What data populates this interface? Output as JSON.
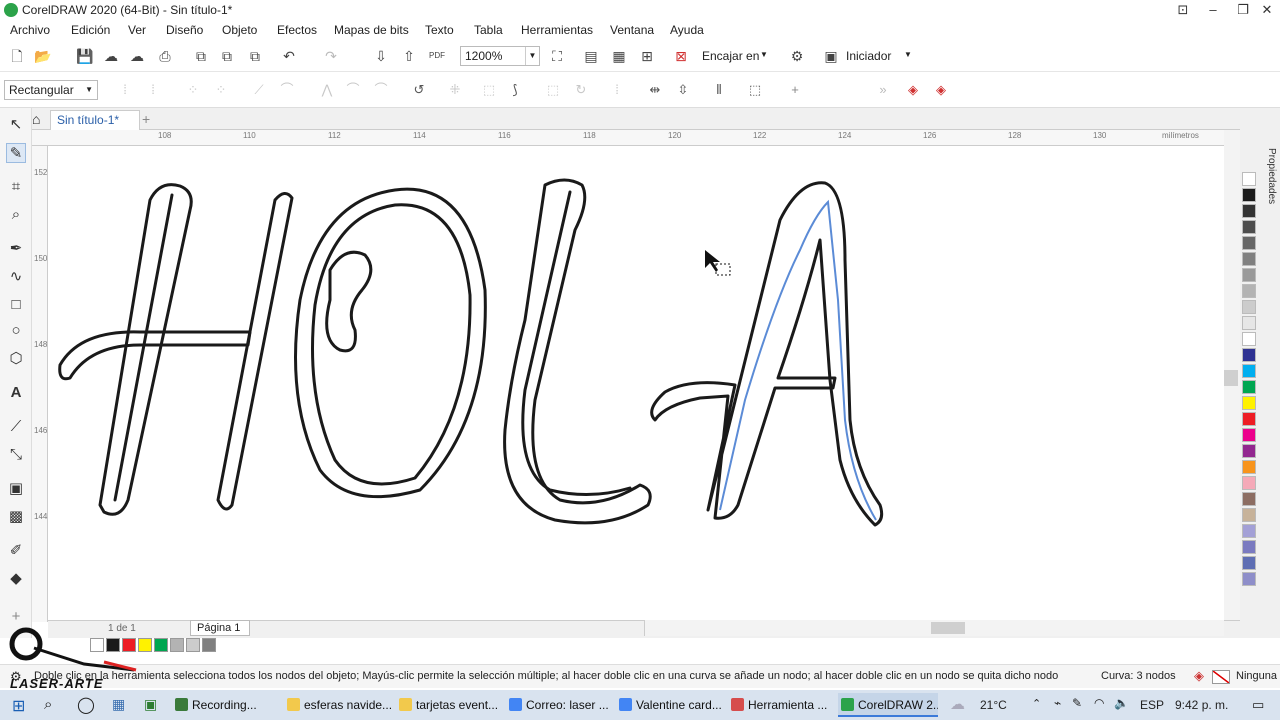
{
  "window": {
    "title": "CorelDRAW 2020 (64-Bit) - Sin título-1*",
    "controls": {
      "minimize": "–",
      "restore": "❐",
      "close": "✕",
      "extra": "⊡"
    }
  },
  "menu": [
    "Archivo",
    "Edición",
    "Ver",
    "Diseño",
    "Objeto",
    "Efectos",
    "Mapas de bits",
    "Texto",
    "Tabla",
    "Herramientas",
    "Ventana",
    "Ayuda"
  ],
  "toolbar": {
    "zoom": "1200%",
    "snap_label": "Encajar en",
    "launcher_label": "Iniciador"
  },
  "property_bar": {
    "shape_mode": "Rectangular"
  },
  "document": {
    "tab_label": "Sin título-1*",
    "add_tab": "+",
    "page_label": "Página 1",
    "page_nav": "1 de 1"
  },
  "ruler": {
    "units": "milímetros",
    "h_ticks": [
      "108",
      "110",
      "112",
      "114",
      "116",
      "118",
      "120",
      "122",
      "124",
      "126",
      "128",
      "130"
    ],
    "v_ticks": [
      "152",
      "150",
      "148",
      "146",
      "144"
    ]
  },
  "canvas": {
    "artwork_text": "HOLA",
    "art_color": "#1a1a1a",
    "selected_path_color": "#5b8bd6"
  },
  "right_panel": {
    "label": "Propiedades"
  },
  "palette": [
    "#ffffff",
    "#1a1a1a",
    "#333333",
    "#4d4d4d",
    "#666666",
    "#808080",
    "#999999",
    "#b3b3b3",
    "#cccccc",
    "#e6e6e6",
    "#ffffff",
    "#2e3192",
    "#00aeef",
    "#00a651",
    "#fff200",
    "#ed1c24",
    "#ec008c",
    "#92278f",
    "#f7941d",
    "#f5a9b8",
    "#8c6d62",
    "#c7b299",
    "#a3a0d6",
    "#7a7ac0",
    "#5e6eb3",
    "#8e8ec9"
  ],
  "doc_palette": [
    "#ffffff",
    "#1a1a1a",
    "#ed1c24",
    "#fff200",
    "#00a651",
    "#b3b3b3",
    "#cccccc",
    "#808080"
  ],
  "status": {
    "hint": "Doble clic en la herramienta selecciona todos los nodos del objeto; Mayús-clic permite la selección múltiple; al hacer doble clic en una curva se añade un nodo; al hacer doble clic en un nodo se quita dicho nodo",
    "object_info": "Curva: 3 nodos",
    "fill": "Ninguna"
  },
  "taskbar": {
    "items": [
      {
        "label": "Recording...",
        "color": "#3a7a3a"
      },
      {
        "label": "esferas navide...",
        "color": "#f2c94c"
      },
      {
        "label": "tarjetas event...",
        "color": "#f2c94c"
      },
      {
        "label": "Correo: laser ...",
        "color": "#4285f4"
      },
      {
        "label": "Valentine card...",
        "color": "#4285f4"
      },
      {
        "label": "Herramienta ...",
        "color": "#d64d4d"
      },
      {
        "label": "CorelDRAW 2...",
        "color": "#2ca34a"
      }
    ],
    "weather": "21°C",
    "language": "ESP",
    "time": "9:42 p. m."
  },
  "watermark": {
    "brand": "LASER-ARTE"
  }
}
